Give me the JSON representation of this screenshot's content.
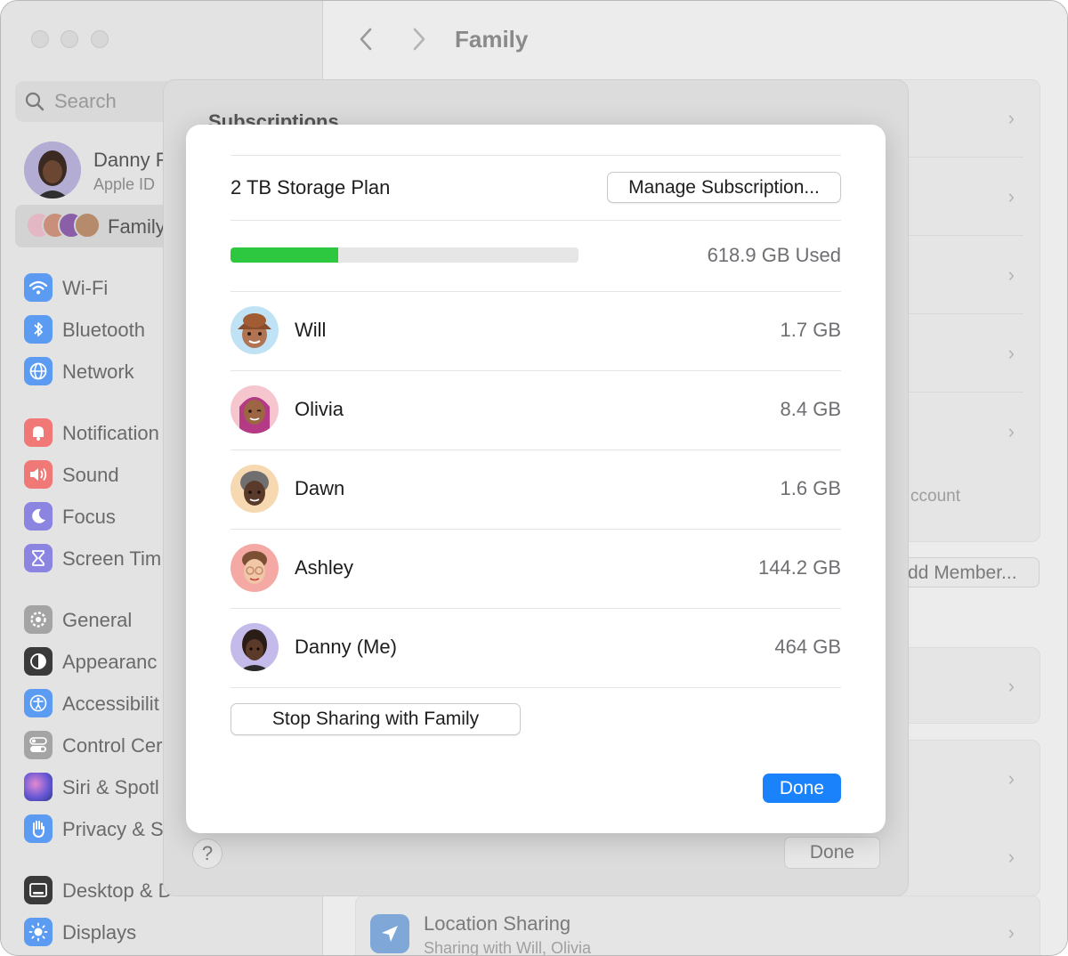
{
  "sidebar": {
    "search_placeholder": "Search",
    "profile": {
      "name": "Danny F",
      "subtitle": "Apple ID"
    },
    "family_label": "Family",
    "items": [
      {
        "label": "Wi-Fi",
        "icon": "wifi-icon",
        "color": "#5b9cf2"
      },
      {
        "label": "Bluetooth",
        "icon": "bluetooth-icon",
        "color": "#5b9cf2"
      },
      {
        "label": "Network",
        "icon": "globe-icon",
        "color": "#5b9cf2"
      },
      {
        "label": "Notification",
        "icon": "bell-icon",
        "color": "#f07876"
      },
      {
        "label": "Sound",
        "icon": "speaker-icon",
        "color": "#f07876"
      },
      {
        "label": "Focus",
        "icon": "moon-icon",
        "color": "#8b84e0"
      },
      {
        "label": "Screen Tim",
        "icon": "hourglass-icon",
        "color": "#8b84e0"
      },
      {
        "label": "General",
        "icon": "gear-icon",
        "color": "#a4a4a4"
      },
      {
        "label": "Appearanc",
        "icon": "appearance-icon",
        "color": "#3a3a3a"
      },
      {
        "label": "Accessibilit",
        "icon": "accessibility-icon",
        "color": "#5b9cf2"
      },
      {
        "label": "Control Cer",
        "icon": "toggles-icon",
        "color": "#a4a4a4"
      },
      {
        "label": "Siri & Spotl",
        "icon": "siri-icon",
        "color": "#8f6fd8"
      },
      {
        "label": "Privacy & S",
        "icon": "hand-icon",
        "color": "#5b9cf2"
      },
      {
        "label": "Desktop & D",
        "icon": "desktop-icon",
        "color": "#3a3a3a"
      },
      {
        "label": "Displays",
        "icon": "sun-icon",
        "color": "#5b9cf2"
      }
    ]
  },
  "main": {
    "title": "Family",
    "back_icon": "chevron-left-icon",
    "forward_icon": "chevron-right-icon",
    "account_text": "ccount",
    "add_member_label": "dd Member...",
    "location": {
      "title": "Location Sharing",
      "subtitle": "Sharing with Will, Olivia"
    }
  },
  "sheet": {
    "heading": "Subscriptions",
    "help_label": "?",
    "done_label": "Done"
  },
  "dialog": {
    "plan_name": "2 TB Storage Plan",
    "manage_label": "Manage Subscription...",
    "usage_text": "618.9 GB Used",
    "usage_fraction": 0.31,
    "usage_color": "#2ec840",
    "members": [
      {
        "name": "Will",
        "size": "1.7 GB"
      },
      {
        "name": "Olivia",
        "size": "8.4 GB"
      },
      {
        "name": "Dawn",
        "size": "1.6 GB"
      },
      {
        "name": "Ashley",
        "size": "144.2 GB"
      },
      {
        "name": "Danny (Me)",
        "size": "464 GB"
      }
    ],
    "stop_sharing_label": "Stop Sharing with Family",
    "done_label": "Done",
    "accent_color": "#1a82fb"
  }
}
